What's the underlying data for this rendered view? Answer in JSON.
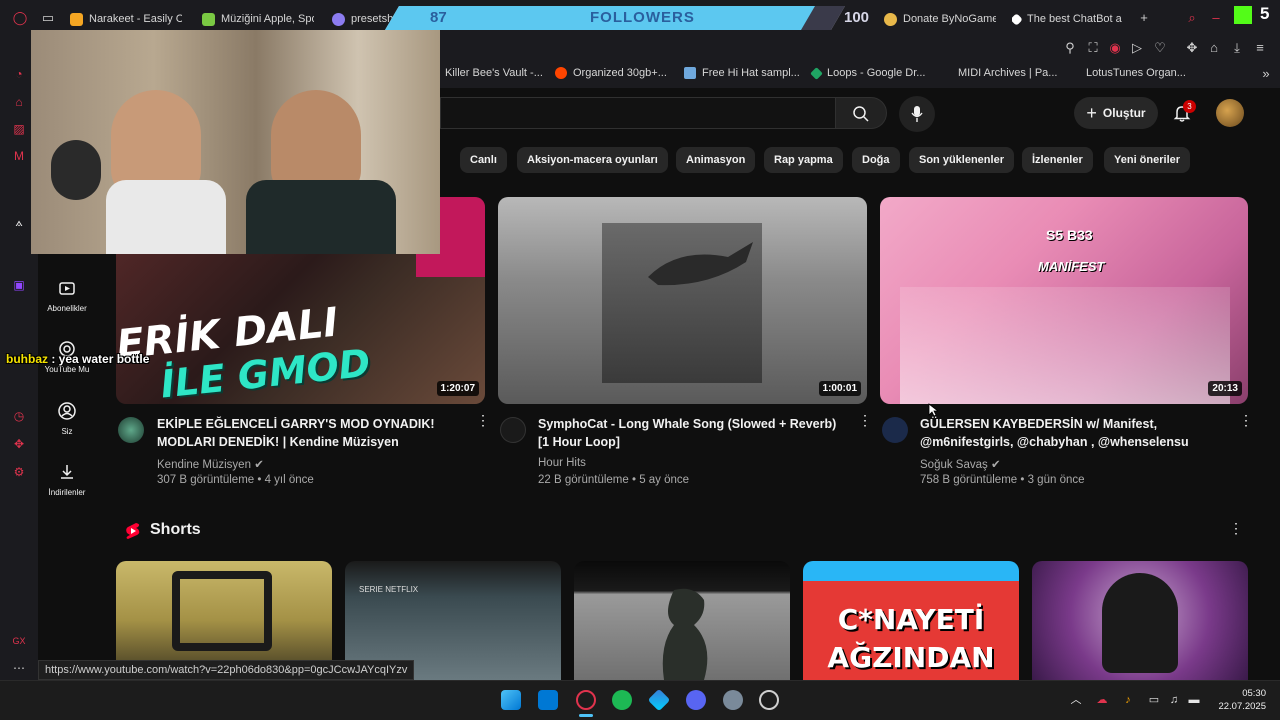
{
  "browser": {
    "tabs": [
      {
        "label": "Narakeet - Easily C",
        "color": "#f5a623"
      },
      {
        "label": "Müziğini Apple, Spo",
        "color": "#7ac943"
      },
      {
        "label": "presetsha",
        "color": "#8c7cf0"
      },
      {
        "label": "Donate ByNoGame",
        "color": "#e8b84a"
      },
      {
        "label": "The best ChatBot a",
        "color": "#ffffff"
      }
    ],
    "bookmarks": [
      {
        "label": "Killer Bee's Vault -..."
      },
      {
        "label": "Organized 30gb+...",
        "color": "#ff4500"
      },
      {
        "label": "Free Hi Hat sampl...",
        "color": "#6fa8dc"
      },
      {
        "label": "Loops - Google Dr...",
        "color": "#1fa463"
      },
      {
        "label": "MIDI Archives | Pa..."
      },
      {
        "label": "LotusTunes Organ..."
      }
    ],
    "status_url": "https://www.youtube.com/watch?v=22ph06do830&pp=0gcJCcwJAYcqIYzv"
  },
  "overlay": {
    "followers_count": "87",
    "followers_label": "FOLLOWERS",
    "followers_goal": "100",
    "kick_count": "5",
    "chat": {
      "user": "buhbaz",
      "separator": " : ",
      "message": "yea water bottle"
    }
  },
  "masthead": {
    "create_label": "Oluştur",
    "notification_count": "3"
  },
  "rail": [
    {
      "label": "Abonelikler",
      "icon": "subscriptions-icon"
    },
    {
      "label": "YouTube Mu",
      "icon": "youtube-music-icon"
    },
    {
      "label": "Siz",
      "icon": "you-icon"
    },
    {
      "label": "İndirilenler",
      "icon": "download-icon"
    }
  ],
  "chips": [
    "Canlı",
    "Aksiyon-macera oyunları",
    "Animasyon",
    "Rap yapma",
    "Doğa",
    "Son yüklenenler",
    "İzlenenler",
    "Yeni öneriler"
  ],
  "videos": [
    {
      "title_line1": "EKİPLE EĞLENCELİ GARRY'S MOD OYNADIK!",
      "title_line2": "MODLARI DENEDİK! | Kendine Müzisyen",
      "channel": "Kendine Müzisyen",
      "meta": "307 B görüntüleme • 4 yıl önce",
      "duration": "1:20:07",
      "thumb_text1": "ERİK DALI",
      "thumb_text2": "İLE GMOD"
    },
    {
      "title_line1": "SymphoCat - Long Whale Song (Slowed + Reverb)",
      "title_line2": "[1 Hour Loop]",
      "channel": "Hour Hits",
      "meta": "22 B görüntüleme • 5 ay önce",
      "duration": "1:00:01"
    },
    {
      "title_line1": "GÜLERSEN KAYBEDERSİN w/ Manifest,",
      "title_line2": "@m6nifestgirls, @chabyhan , @whenselensu",
      "channel": "Soğuk Savaş",
      "meta": "758 B görüntüleme • 3 gün önce",
      "duration": "20:13",
      "thumb_text1": "S5 B33",
      "thumb_text2": "MANİFEST"
    }
  ],
  "shorts": {
    "title": "Shorts",
    "items": [
      {
        "text": ""
      },
      {
        "text": "SERIE NETFLIX"
      },
      {
        "text": ""
      },
      {
        "text": "C*NAYETİ AĞZINDAN"
      },
      {
        "text": ""
      }
    ]
  },
  "taskbar": {
    "time": "05:30",
    "date": "22.07.2025"
  }
}
